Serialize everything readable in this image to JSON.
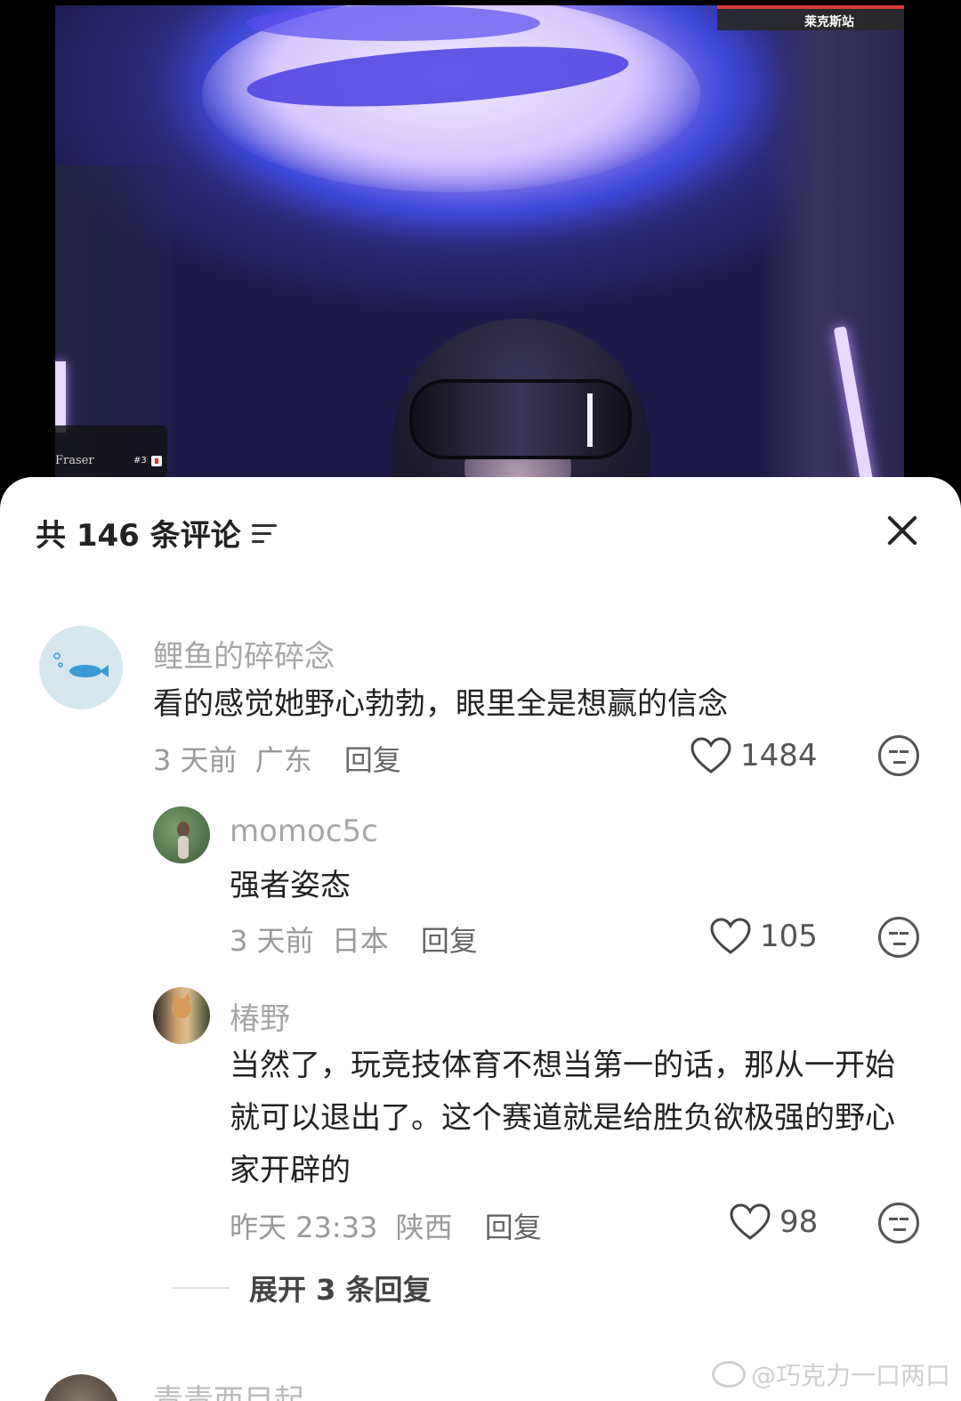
{
  "video": {
    "overlay_label": "莱克斯站",
    "athlete_name": "Fraser",
    "bib_number": "#3"
  },
  "sheet": {
    "header_title": "共 146 条评论",
    "sort_icon": "filter-sort-icon",
    "close_icon": "close-icon"
  },
  "comments": [
    {
      "username": "鲤鱼的碎碎念",
      "text": "看的感觉她野心勃勃，眼里全是想赢的信念",
      "time": "3 天前",
      "location": "广东",
      "reply_label": "回复",
      "likes": "1484"
    },
    {
      "username": "momoc5c",
      "text": "强者姿态",
      "time": "3 天前",
      "location": "日本",
      "reply_label": "回复",
      "likes": "105"
    },
    {
      "username": "椿野",
      "text": "当然了，玩竞技体育不想当第一的话，那从一开始就可以退出了。这个赛道就是给胜负欲极强的野心家开辟的",
      "time": "昨天 23:33",
      "location": "陕西",
      "reply_label": "回复",
      "likes": "98"
    }
  ],
  "expand_label": "展开 3 条回复",
  "next_comment": {
    "username": "青青西目起"
  },
  "watermark": "@巧克力一口两口",
  "colors": {
    "sheet_bg": "#ffffff",
    "username": "#a6a6a6",
    "text": "#222222",
    "meta": "#999999"
  }
}
